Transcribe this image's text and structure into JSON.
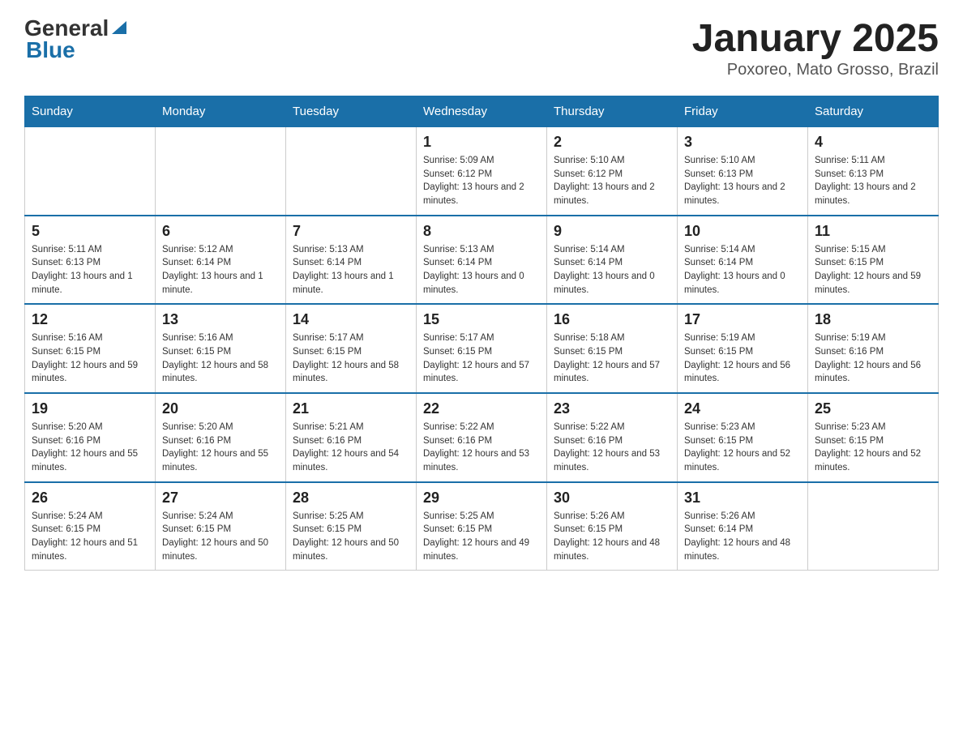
{
  "header": {
    "logo_general": "General",
    "logo_blue": "Blue",
    "title": "January 2025",
    "subtitle": "Poxoreo, Mato Grosso, Brazil"
  },
  "weekdays": [
    "Sunday",
    "Monday",
    "Tuesday",
    "Wednesday",
    "Thursday",
    "Friday",
    "Saturday"
  ],
  "weeks": [
    [
      {
        "day": "",
        "info": ""
      },
      {
        "day": "",
        "info": ""
      },
      {
        "day": "",
        "info": ""
      },
      {
        "day": "1",
        "info": "Sunrise: 5:09 AM\nSunset: 6:12 PM\nDaylight: 13 hours and 2 minutes."
      },
      {
        "day": "2",
        "info": "Sunrise: 5:10 AM\nSunset: 6:12 PM\nDaylight: 13 hours and 2 minutes."
      },
      {
        "day": "3",
        "info": "Sunrise: 5:10 AM\nSunset: 6:13 PM\nDaylight: 13 hours and 2 minutes."
      },
      {
        "day": "4",
        "info": "Sunrise: 5:11 AM\nSunset: 6:13 PM\nDaylight: 13 hours and 2 minutes."
      }
    ],
    [
      {
        "day": "5",
        "info": "Sunrise: 5:11 AM\nSunset: 6:13 PM\nDaylight: 13 hours and 1 minute."
      },
      {
        "day": "6",
        "info": "Sunrise: 5:12 AM\nSunset: 6:14 PM\nDaylight: 13 hours and 1 minute."
      },
      {
        "day": "7",
        "info": "Sunrise: 5:13 AM\nSunset: 6:14 PM\nDaylight: 13 hours and 1 minute."
      },
      {
        "day": "8",
        "info": "Sunrise: 5:13 AM\nSunset: 6:14 PM\nDaylight: 13 hours and 0 minutes."
      },
      {
        "day": "9",
        "info": "Sunrise: 5:14 AM\nSunset: 6:14 PM\nDaylight: 13 hours and 0 minutes."
      },
      {
        "day": "10",
        "info": "Sunrise: 5:14 AM\nSunset: 6:14 PM\nDaylight: 13 hours and 0 minutes."
      },
      {
        "day": "11",
        "info": "Sunrise: 5:15 AM\nSunset: 6:15 PM\nDaylight: 12 hours and 59 minutes."
      }
    ],
    [
      {
        "day": "12",
        "info": "Sunrise: 5:16 AM\nSunset: 6:15 PM\nDaylight: 12 hours and 59 minutes."
      },
      {
        "day": "13",
        "info": "Sunrise: 5:16 AM\nSunset: 6:15 PM\nDaylight: 12 hours and 58 minutes."
      },
      {
        "day": "14",
        "info": "Sunrise: 5:17 AM\nSunset: 6:15 PM\nDaylight: 12 hours and 58 minutes."
      },
      {
        "day": "15",
        "info": "Sunrise: 5:17 AM\nSunset: 6:15 PM\nDaylight: 12 hours and 57 minutes."
      },
      {
        "day": "16",
        "info": "Sunrise: 5:18 AM\nSunset: 6:15 PM\nDaylight: 12 hours and 57 minutes."
      },
      {
        "day": "17",
        "info": "Sunrise: 5:19 AM\nSunset: 6:15 PM\nDaylight: 12 hours and 56 minutes."
      },
      {
        "day": "18",
        "info": "Sunrise: 5:19 AM\nSunset: 6:16 PM\nDaylight: 12 hours and 56 minutes."
      }
    ],
    [
      {
        "day": "19",
        "info": "Sunrise: 5:20 AM\nSunset: 6:16 PM\nDaylight: 12 hours and 55 minutes."
      },
      {
        "day": "20",
        "info": "Sunrise: 5:20 AM\nSunset: 6:16 PM\nDaylight: 12 hours and 55 minutes."
      },
      {
        "day": "21",
        "info": "Sunrise: 5:21 AM\nSunset: 6:16 PM\nDaylight: 12 hours and 54 minutes."
      },
      {
        "day": "22",
        "info": "Sunrise: 5:22 AM\nSunset: 6:16 PM\nDaylight: 12 hours and 53 minutes."
      },
      {
        "day": "23",
        "info": "Sunrise: 5:22 AM\nSunset: 6:16 PM\nDaylight: 12 hours and 53 minutes."
      },
      {
        "day": "24",
        "info": "Sunrise: 5:23 AM\nSunset: 6:15 PM\nDaylight: 12 hours and 52 minutes."
      },
      {
        "day": "25",
        "info": "Sunrise: 5:23 AM\nSunset: 6:15 PM\nDaylight: 12 hours and 52 minutes."
      }
    ],
    [
      {
        "day": "26",
        "info": "Sunrise: 5:24 AM\nSunset: 6:15 PM\nDaylight: 12 hours and 51 minutes."
      },
      {
        "day": "27",
        "info": "Sunrise: 5:24 AM\nSunset: 6:15 PM\nDaylight: 12 hours and 50 minutes."
      },
      {
        "day": "28",
        "info": "Sunrise: 5:25 AM\nSunset: 6:15 PM\nDaylight: 12 hours and 50 minutes."
      },
      {
        "day": "29",
        "info": "Sunrise: 5:25 AM\nSunset: 6:15 PM\nDaylight: 12 hours and 49 minutes."
      },
      {
        "day": "30",
        "info": "Sunrise: 5:26 AM\nSunset: 6:15 PM\nDaylight: 12 hours and 48 minutes."
      },
      {
        "day": "31",
        "info": "Sunrise: 5:26 AM\nSunset: 6:14 PM\nDaylight: 12 hours and 48 minutes."
      },
      {
        "day": "",
        "info": ""
      }
    ]
  ]
}
